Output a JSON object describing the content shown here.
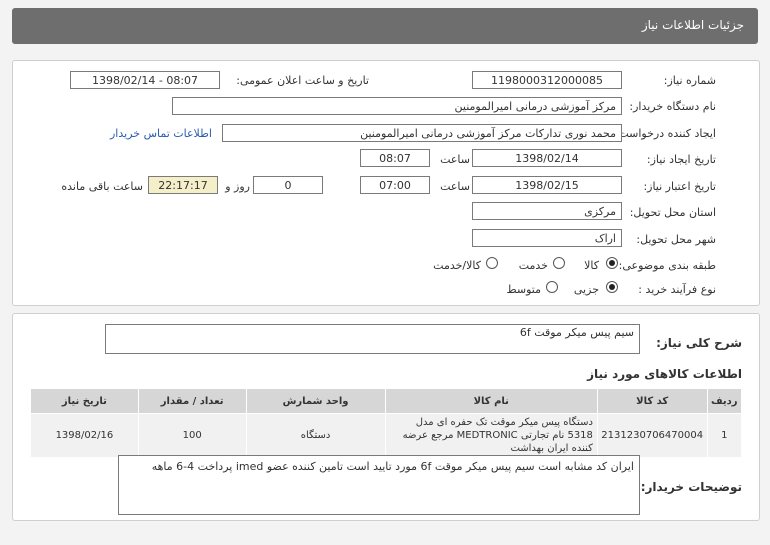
{
  "header": {
    "title": "جزئیات اطلاعات نیاز"
  },
  "form": {
    "need_number_label": "شماره نیاز:",
    "need_number": "1198000312000085",
    "announce_label": "تاریخ و ساعت اعلان عمومی:",
    "announce_value": "1398/02/14 - 08:07",
    "buyer_label": "نام دستگاه خریدار:",
    "buyer_value": "مرکز آموزشی درمانی امیرالمومنین",
    "creator_label": "ایجاد کننده درخواست:",
    "creator_value": "محمد نوری تدارکات مرکز آموزشی درمانی امیرالمومنین",
    "contact_link": "اطلاعات تماس خریدار",
    "created_date_label": "تاریخ ایجاد نیاز:",
    "created_date": "1398/02/14",
    "time_label": "ساعت",
    "created_time": "08:07",
    "validity_label": "تاریخ اعتبار نیاز:",
    "validity_date": "1398/02/15",
    "validity_time": "07:00",
    "days_value": "0",
    "days_label": "روز و",
    "remaining_time": "22:17:17",
    "remaining_label": "ساعت باقی مانده",
    "province_label": "استان محل تحویل:",
    "province_value": "مرکزی",
    "city_label": "شهر محل تحویل:",
    "city_value": "اراک",
    "category_label": "طبقه بندی موضوعی:",
    "category_options": [
      "کالا",
      "خدمت",
      "کالا/خدمت"
    ],
    "process_label": "نوع فرآیند خرید :",
    "process_options": [
      "جزیی",
      "متوسط"
    ]
  },
  "summary": {
    "label": "شرح کلی نیاز:",
    "value": "سیم پیس میکر موقت 6f"
  },
  "goods": {
    "section_title": "اطلاعات کالاهای مورد نیاز",
    "headers": [
      "ردیف",
      "کد کالا",
      "نام کالا",
      "واحد شمارش",
      "تعداد / مقدار",
      "تاریخ نیاز"
    ],
    "rows": [
      {
        "row": "1",
        "code": "2131230706470004",
        "name": "دستگاه پیس میکر موقت تک حفره ای مدل 5318 نام تجارتی MEDTRONIC مرجع عرضه کننده ایران بهداشت",
        "unit": "دستگاه",
        "qty": "100",
        "date": "1398/02/16"
      }
    ]
  },
  "buyer_notes": {
    "label": "توضیحات خریدار:",
    "value": "ایران کد مشابه است سیم پیس میکر موقت 6f  مورد تایید است تامین کننده عضو imed پرداخت 4-6 ماهه"
  },
  "colors": {
    "header_bg": "#6e6e6e",
    "remaining_bg": "#f4efc8",
    "link": "#2a5db0"
  }
}
